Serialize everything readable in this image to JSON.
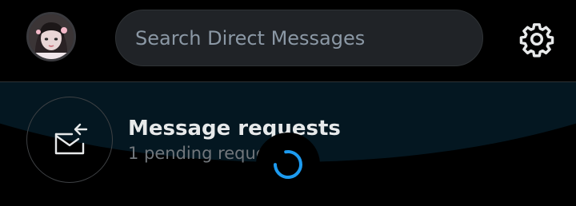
{
  "header": {
    "search": {
      "placeholder": "Search Direct Messages",
      "value": ""
    },
    "avatar_icon": "profile-avatar",
    "settings_icon": "gear-icon"
  },
  "message_requests": {
    "title": "Message requests",
    "subtitle": "1 pending request",
    "icon": "mail-return-icon"
  },
  "status": {
    "loading": true
  },
  "colors": {
    "background": "#000000",
    "search_bg": "#202327",
    "accent": "#1d9bf0",
    "text_primary": "#e7e9ea",
    "text_secondary": "#71767b",
    "glow": "#041721"
  }
}
